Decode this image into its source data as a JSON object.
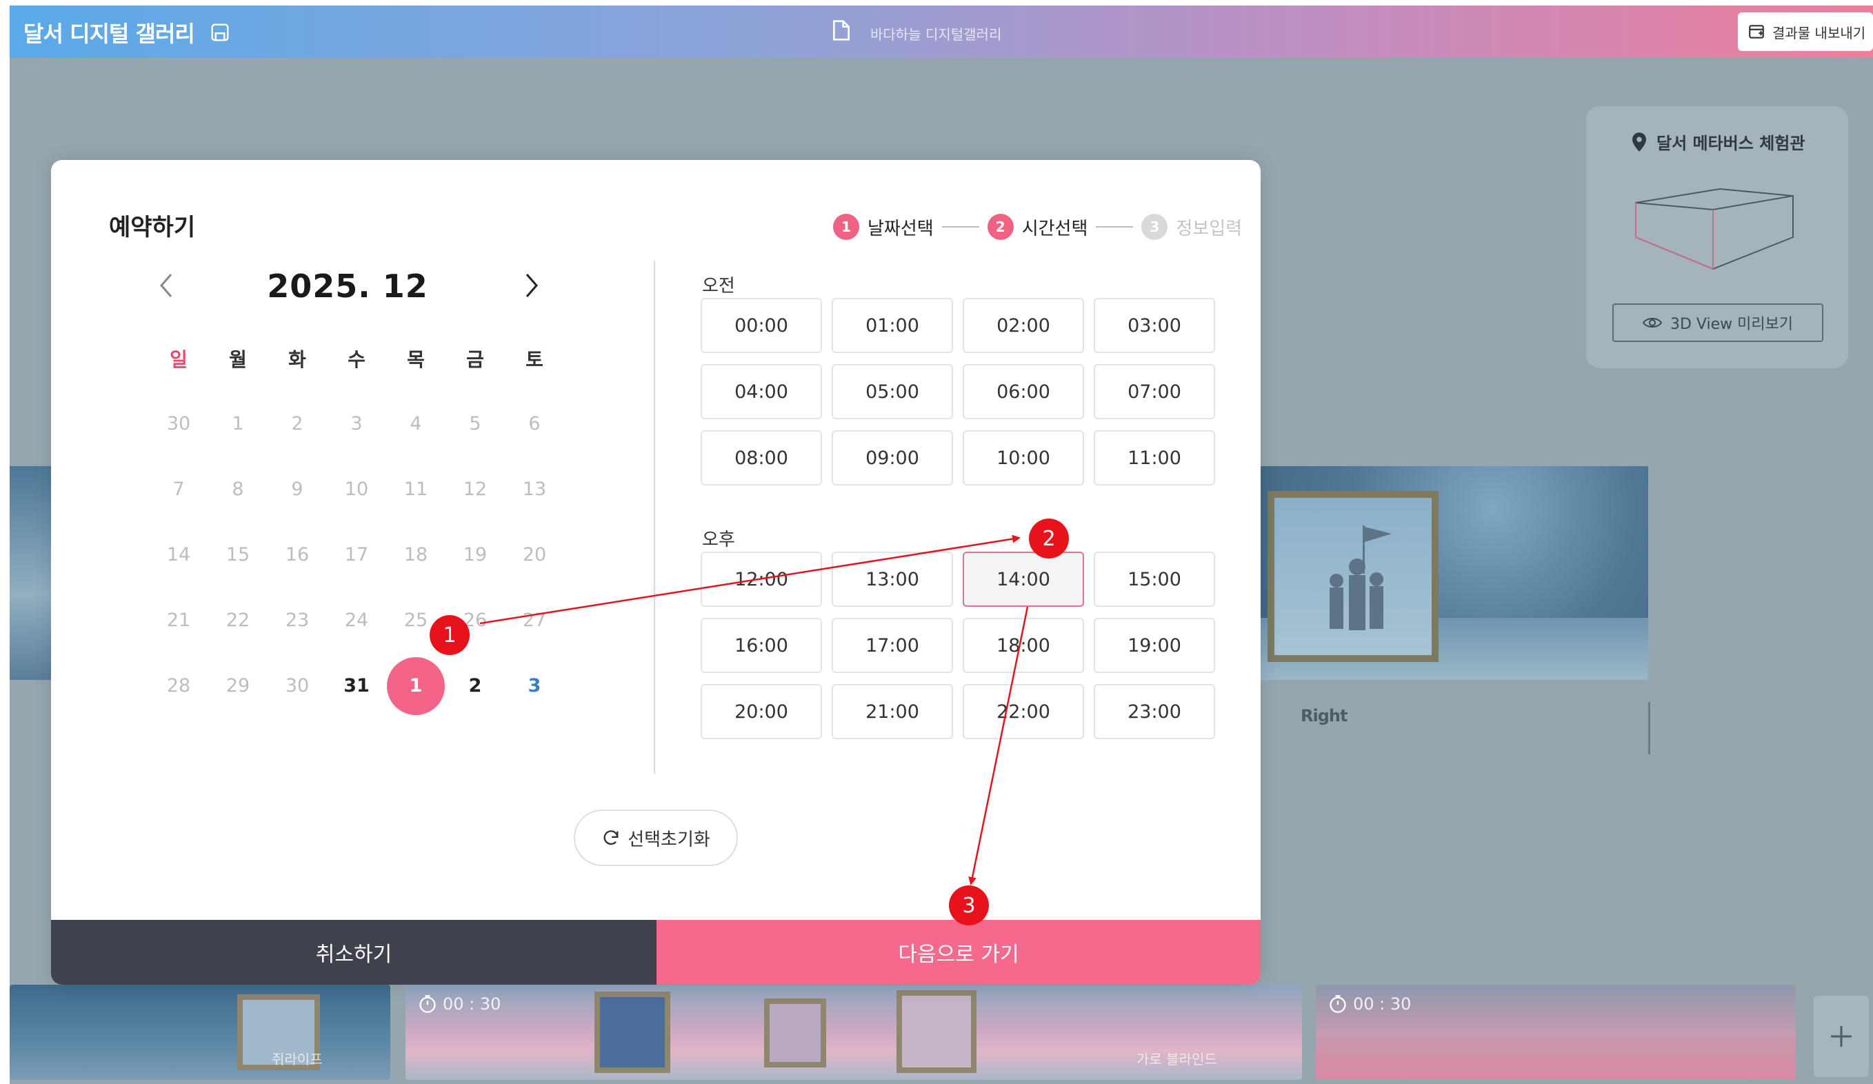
{
  "topbar": {
    "app_title": "달서 디지털 갤러리",
    "doc_title": "바다하늘 디지털갤러리",
    "export_label": "결과물 내보내기"
  },
  "preview": {
    "venue_name": "달서 메타버스 체험관",
    "view3d_label": "3D View 미리보기"
  },
  "scene": {
    "right_label": "Right"
  },
  "filmstrip": {
    "thumbs": [
      {
        "caption": "쥐라이프"
      },
      {
        "timer": "00 : 30",
        "caption": "가로 블라인드"
      },
      {
        "timer": "00 : 30"
      }
    ]
  },
  "modal": {
    "title": "예약하기",
    "steps": [
      {
        "num": "1",
        "label": "날짜선택"
      },
      {
        "num": "2",
        "label": "시간선택"
      },
      {
        "num": "3",
        "label": "정보입력"
      }
    ],
    "calendar": {
      "month": "2025. 12",
      "weekdays": [
        "일",
        "월",
        "화",
        "수",
        "목",
        "금",
        "토"
      ],
      "weeks": [
        [
          "30",
          "1",
          "2",
          "3",
          "4",
          "5",
          "6"
        ],
        [
          "7",
          "8",
          "9",
          "10",
          "11",
          "12",
          "13"
        ],
        [
          "14",
          "15",
          "16",
          "17",
          "18",
          "19",
          "20"
        ],
        [
          "21",
          "22",
          "23",
          "24",
          "25",
          "26",
          "27"
        ],
        [
          "28",
          "29",
          "30",
          "31",
          "1",
          "2",
          "3"
        ]
      ],
      "selected_date": "1"
    },
    "am_label": "오전",
    "pm_label": "오후",
    "am_slots": [
      "00:00",
      "01:00",
      "02:00",
      "03:00",
      "04:00",
      "05:00",
      "06:00",
      "07:00",
      "08:00",
      "09:00",
      "10:00",
      "11:00"
    ],
    "pm_slots": [
      "12:00",
      "13:00",
      "14:00",
      "15:00",
      "16:00",
      "17:00",
      "18:00",
      "19:00",
      "20:00",
      "21:00",
      "22:00",
      "23:00"
    ],
    "selected_slot": "14:00",
    "reset_label": "선택초기화",
    "cancel_label": "취소하기",
    "next_label": "다음으로 가기"
  },
  "annotations": [
    "1",
    "2",
    "3"
  ],
  "colors": {
    "accent": "#f4698c",
    "cancel_bg": "#3f414d",
    "marker": "#e8121b",
    "saturday": "#3a7ec4",
    "sunday": "#e94a6b"
  }
}
